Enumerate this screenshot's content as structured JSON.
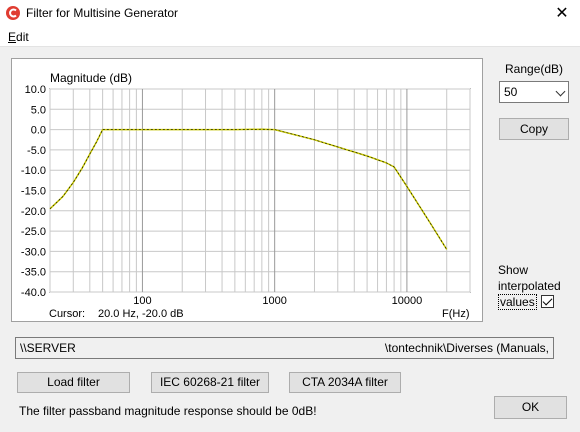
{
  "window": {
    "title": "Filter for Multisine Generator",
    "close_symbol": "✕"
  },
  "menu": {
    "items": [
      {
        "label": "Edit"
      }
    ]
  },
  "chart": {
    "ylabel": "Magnitude (dB)",
    "cursor_label": "Cursor:",
    "cursor_value": "20.0 Hz, -20.0 dB",
    "xlabel": "F(Hz)"
  },
  "chart_data": {
    "type": "line",
    "title": "",
    "ylabel": "Magnitude (dB)",
    "xlabel": "F(Hz)",
    "x_scale": "log",
    "xlim": [
      20,
      30000
    ],
    "ylim": [
      -40,
      10
    ],
    "y_ticks": [
      10,
      5,
      0,
      -5,
      -10,
      -15,
      -20,
      -25,
      -30,
      -35,
      -40
    ],
    "y_tick_labels": [
      "10.0",
      "5.0",
      "0.0",
      "-5.0",
      "-10.0",
      "-15.0",
      "-20.0",
      "-25.0",
      "-30.0",
      "-35.0",
      "-40.0"
    ],
    "x_tick_values": [
      100,
      1000,
      10000
    ],
    "x_tick_labels": [
      "100",
      "1000",
      "10000"
    ],
    "grid": true,
    "line_color": "#c8c800",
    "series": [
      {
        "x": [
          20,
          25,
          30,
          35,
          40,
          45,
          50,
          100,
          500,
          800,
          1000,
          2000,
          5000,
          7000,
          8000,
          10000,
          15000,
          20000
        ],
        "y": [
          -19.5,
          -16.5,
          -13,
          -9.5,
          -6,
          -3,
          0,
          0,
          0,
          0.1,
          0,
          -2.5,
          -6.5,
          -8.2,
          -9.2,
          -14,
          -23,
          -29.5
        ]
      }
    ]
  },
  "range": {
    "label": "Range(dB)",
    "value": "50"
  },
  "buttons": {
    "copy": "Copy",
    "load_filter": "Load filter",
    "iec": "IEC 60268-21 filter",
    "cta": "CTA 2034A filter",
    "ok": "OK"
  },
  "show_interpolated": {
    "line1": "Show",
    "line2": "interpolated",
    "line3": "values",
    "checked": true
  },
  "path": {
    "left": "\\\\SERVER",
    "right": "\\tontechnik\\Diverses (Manuals,"
  },
  "status": "The filter passband magnitude response should be 0dB!",
  "colors": {
    "app_icon": "#e03c31",
    "accent_line": "#c8c800",
    "grid": "#c8c8c8"
  }
}
